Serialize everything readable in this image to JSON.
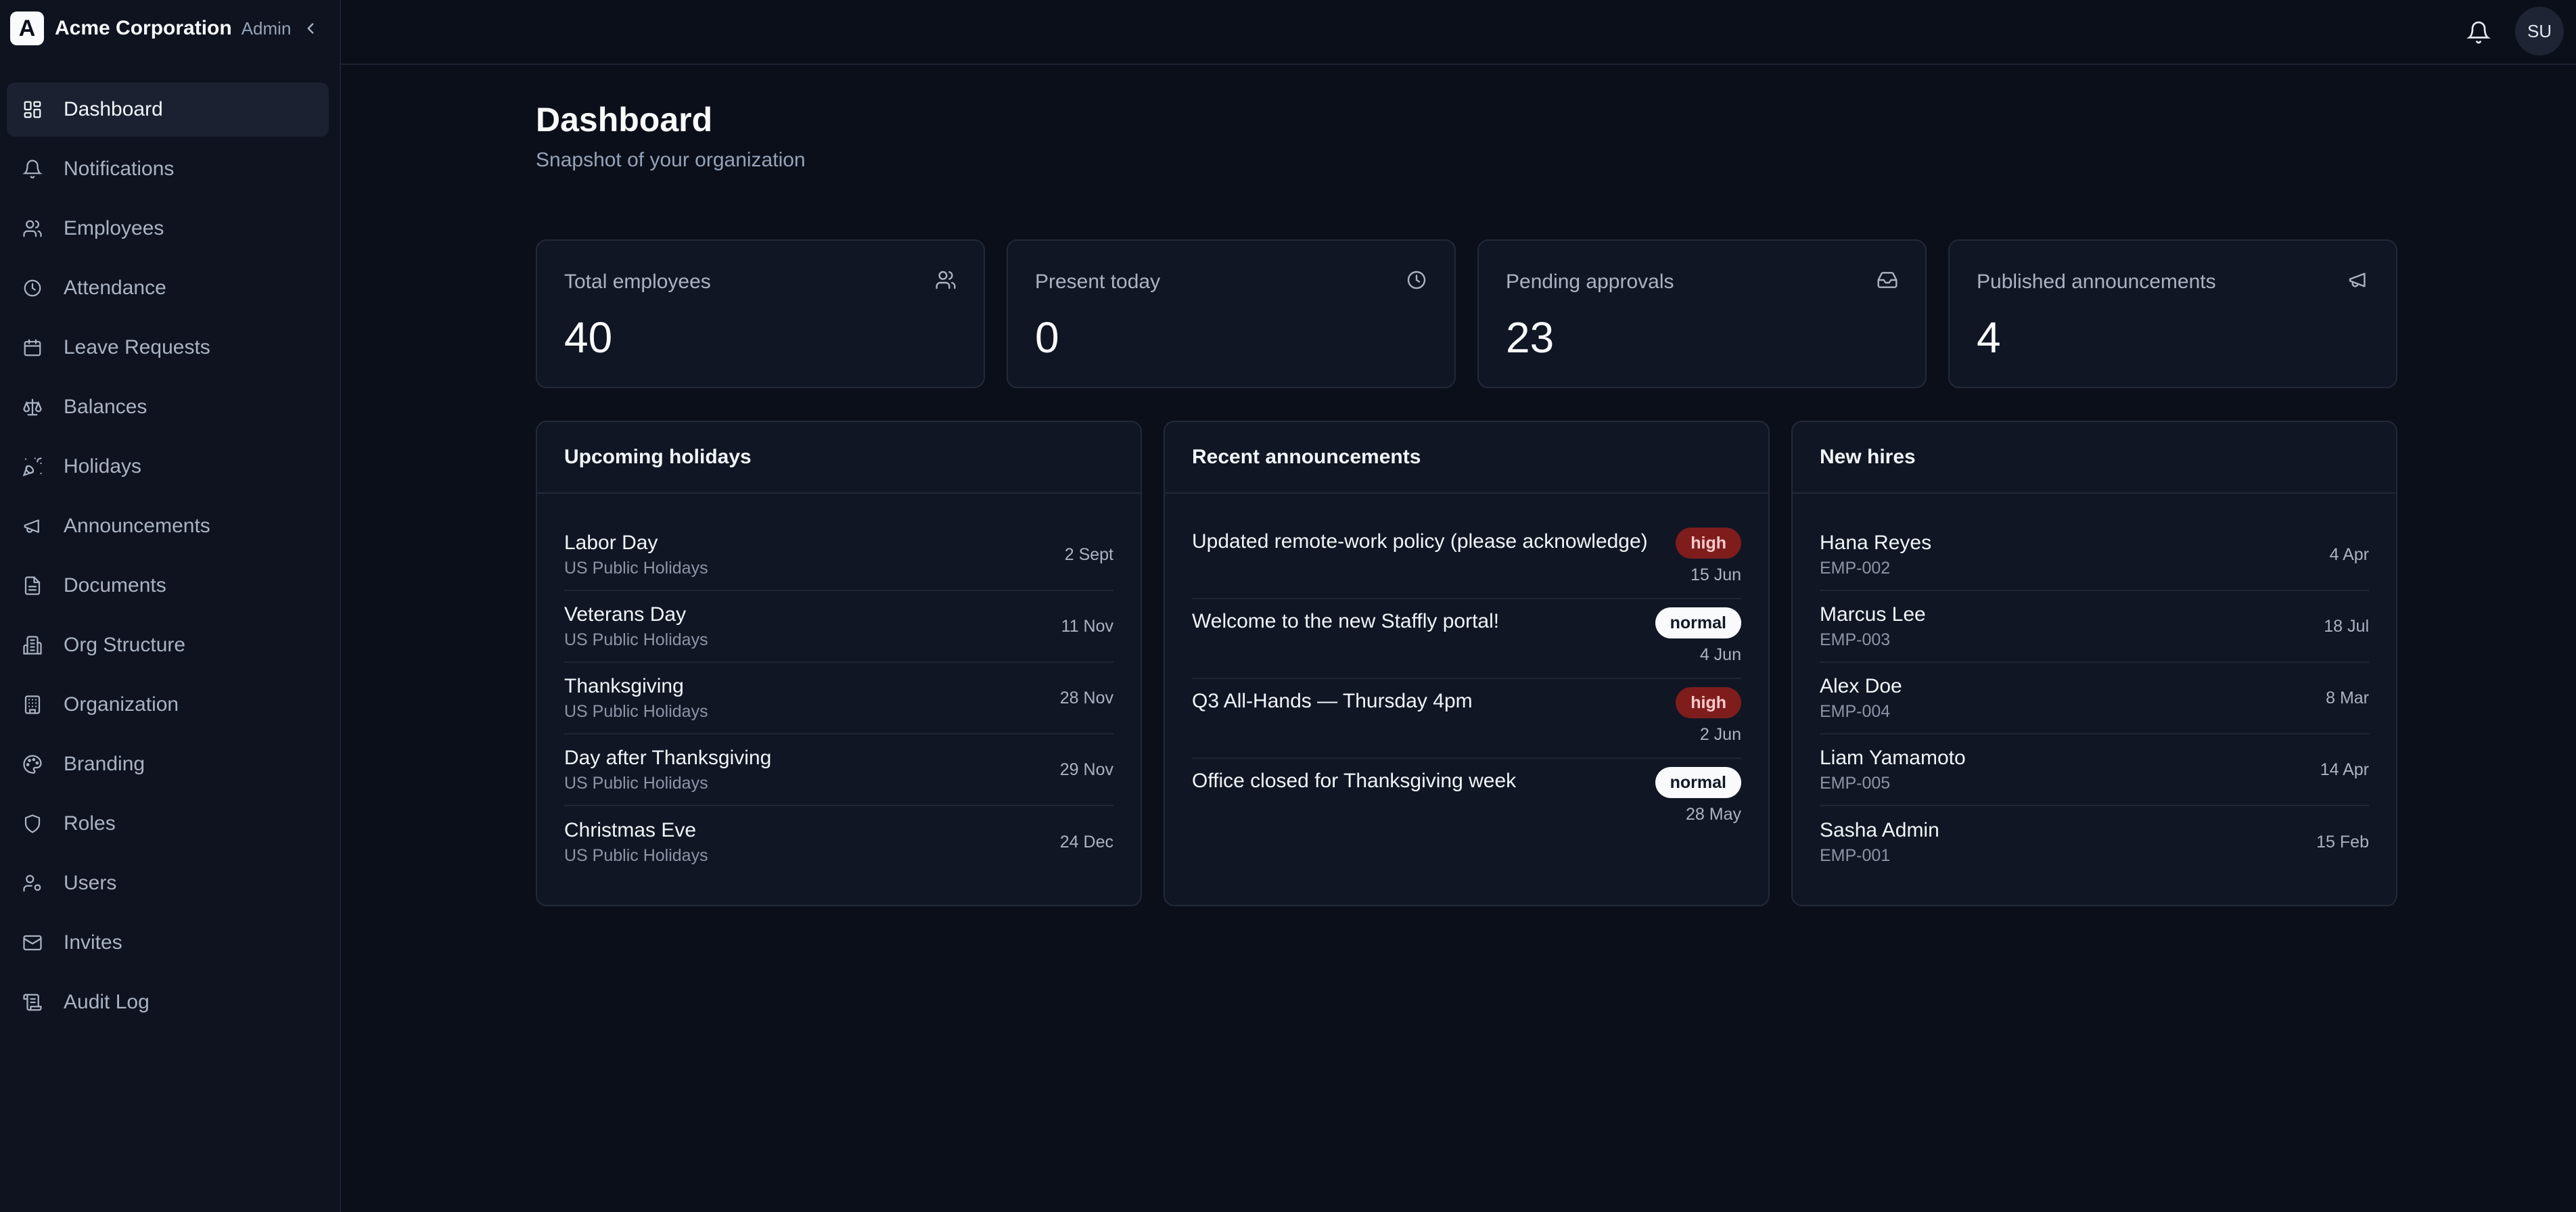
{
  "brand": {
    "logo_letter": "A",
    "name": "Acme Corporation",
    "role": "Admin"
  },
  "sidebar": {
    "items": [
      {
        "label": "Dashboard",
        "icon": "dashboard-icon",
        "active": true
      },
      {
        "label": "Notifications",
        "icon": "bell-icon"
      },
      {
        "label": "Employees",
        "icon": "users-icon"
      },
      {
        "label": "Attendance",
        "icon": "clock-icon"
      },
      {
        "label": "Leave Requests",
        "icon": "calendar-icon"
      },
      {
        "label": "Balances",
        "icon": "scale-icon"
      },
      {
        "label": "Holidays",
        "icon": "party-popper-icon"
      },
      {
        "label": "Announcements",
        "icon": "megaphone-icon"
      },
      {
        "label": "Documents",
        "icon": "file-icon"
      },
      {
        "label": "Org Structure",
        "icon": "building-icon"
      },
      {
        "label": "Organization",
        "icon": "office-icon"
      },
      {
        "label": "Branding",
        "icon": "palette-icon"
      },
      {
        "label": "Roles",
        "icon": "shield-icon"
      },
      {
        "label": "Users",
        "icon": "user-cog-icon"
      },
      {
        "label": "Invites",
        "icon": "mail-icon"
      },
      {
        "label": "Audit Log",
        "icon": "scroll-icon"
      }
    ]
  },
  "header": {
    "avatar_initials": "SU"
  },
  "page": {
    "title": "Dashboard",
    "subtitle": "Snapshot of your organization"
  },
  "stats": [
    {
      "label": "Total employees",
      "value": "40",
      "icon": "users-icon"
    },
    {
      "label": "Present today",
      "value": "0",
      "icon": "clock-icon"
    },
    {
      "label": "Pending approvals",
      "value": "23",
      "icon": "inbox-icon"
    },
    {
      "label": "Published announcements",
      "value": "4",
      "icon": "megaphone-icon"
    }
  ],
  "holidays": {
    "title": "Upcoming holidays",
    "items": [
      {
        "name": "Labor Day",
        "calendar": "US Public Holidays",
        "date": "2 Sept"
      },
      {
        "name": "Veterans Day",
        "calendar": "US Public Holidays",
        "date": "11 Nov"
      },
      {
        "name": "Thanksgiving",
        "calendar": "US Public Holidays",
        "date": "28 Nov"
      },
      {
        "name": "Day after Thanksgiving",
        "calendar": "US Public Holidays",
        "date": "29 Nov"
      },
      {
        "name": "Christmas Eve",
        "calendar": "US Public Holidays",
        "date": "24 Dec"
      }
    ]
  },
  "announcements": {
    "title": "Recent announcements",
    "items": [
      {
        "title": "Updated remote-work policy (please acknowledge)",
        "priority": "high",
        "date": "15 Jun"
      },
      {
        "title": "Welcome to the new Staffly portal!",
        "priority": "normal",
        "date": "4 Jun"
      },
      {
        "title": "Q3 All-Hands — Thursday 4pm",
        "priority": "high",
        "date": "2 Jun"
      },
      {
        "title": "Office closed for Thanksgiving week",
        "priority": "normal",
        "date": "28 May"
      }
    ]
  },
  "new_hires": {
    "title": "New hires",
    "items": [
      {
        "name": "Hana Reyes",
        "code": "EMP-002",
        "date": "4 Apr"
      },
      {
        "name": "Marcus Lee",
        "code": "EMP-003",
        "date": "18 Jul"
      },
      {
        "name": "Alex Doe",
        "code": "EMP-004",
        "date": "8 Mar"
      },
      {
        "name": "Liam Yamamoto",
        "code": "EMP-005",
        "date": "14 Apr"
      },
      {
        "name": "Sasha Admin",
        "code": "EMP-001",
        "date": "15 Feb"
      }
    ]
  },
  "colors": {
    "background": "#0b0f19",
    "sidebar": "#0e131f",
    "card": "#111624",
    "badge_high": "#7f1d1d",
    "badge_normal": "#f8fafc"
  }
}
